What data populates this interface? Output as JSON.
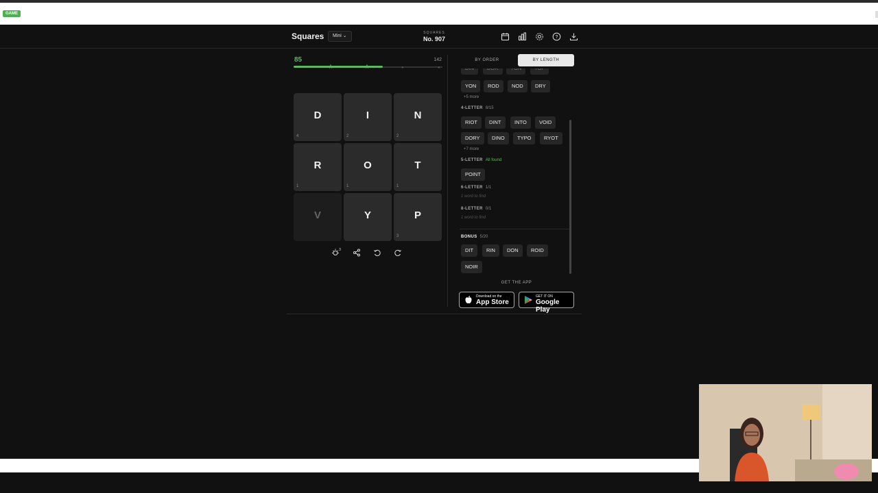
{
  "browser": {
    "badge": "GAME"
  },
  "header": {
    "title": "Squares",
    "mode": "Mini",
    "puzzle_label": "SQUARES",
    "puzzle_number": "No. 907",
    "icons": [
      "calendar-icon",
      "stats-icon",
      "settings-icon",
      "help-icon",
      "download-icon"
    ]
  },
  "score": {
    "current": "85",
    "max": "142",
    "progress_fraction": 0.6
  },
  "grid": {
    "tiles": [
      {
        "letter": "D",
        "count": "4",
        "used": false
      },
      {
        "letter": "I",
        "count": "2",
        "used": false
      },
      {
        "letter": "N",
        "count": "2",
        "used": false
      },
      {
        "letter": "R",
        "count": "1",
        "used": false
      },
      {
        "letter": "O",
        "count": "1",
        "used": false
      },
      {
        "letter": "T",
        "count": "1",
        "used": false
      },
      {
        "letter": "V",
        "count": "",
        "used": true
      },
      {
        "letter": "Y",
        "count": "",
        "used": false
      },
      {
        "letter": "P",
        "count": "3",
        "used": false
      }
    ]
  },
  "actions": {
    "hint_count": "3",
    "icons": [
      "hint-icon",
      "share-icon",
      "undo-icon",
      "refresh-icon"
    ]
  },
  "tabs": {
    "by_order": "BY ORDER",
    "by_length": "BY LENGTH"
  },
  "words": {
    "cut_row": [
      "DIN",
      "DOR",
      "YON",
      "TOP"
    ],
    "three_row": [
      "YON",
      "ROD",
      "NOD",
      "DRY"
    ],
    "three_more": "+5 more",
    "four_title": "4-LETTER",
    "four_count": "8/15",
    "four_row1": [
      "RIOT",
      "DINT",
      "INTO",
      "VOID"
    ],
    "four_row2": [
      "DORY",
      "DINO",
      "TYPO",
      "RYOT"
    ],
    "four_more": "+7 more",
    "five_title": "5-LETTER",
    "five_status": "All found",
    "five_words": [
      "POINT"
    ],
    "six_title": "6-LETTER",
    "six_count": "1/1",
    "six_hint": "1 word to find",
    "eight_title": "8-LETTER",
    "eight_count": "0/1",
    "eight_hint": "1 word to find",
    "bonus_title": "BONUS",
    "bonus_count": "5/20",
    "bonus_row1": [
      "DIT",
      "RIN",
      "DON",
      "ROID"
    ],
    "bonus_row2": [
      "NOIR"
    ]
  },
  "app": {
    "get_label": "GET THE APP",
    "appstore_small": "Download on the",
    "appstore_big": "App Store",
    "google_small": "GET IT ON",
    "google_big": "Google Play"
  }
}
